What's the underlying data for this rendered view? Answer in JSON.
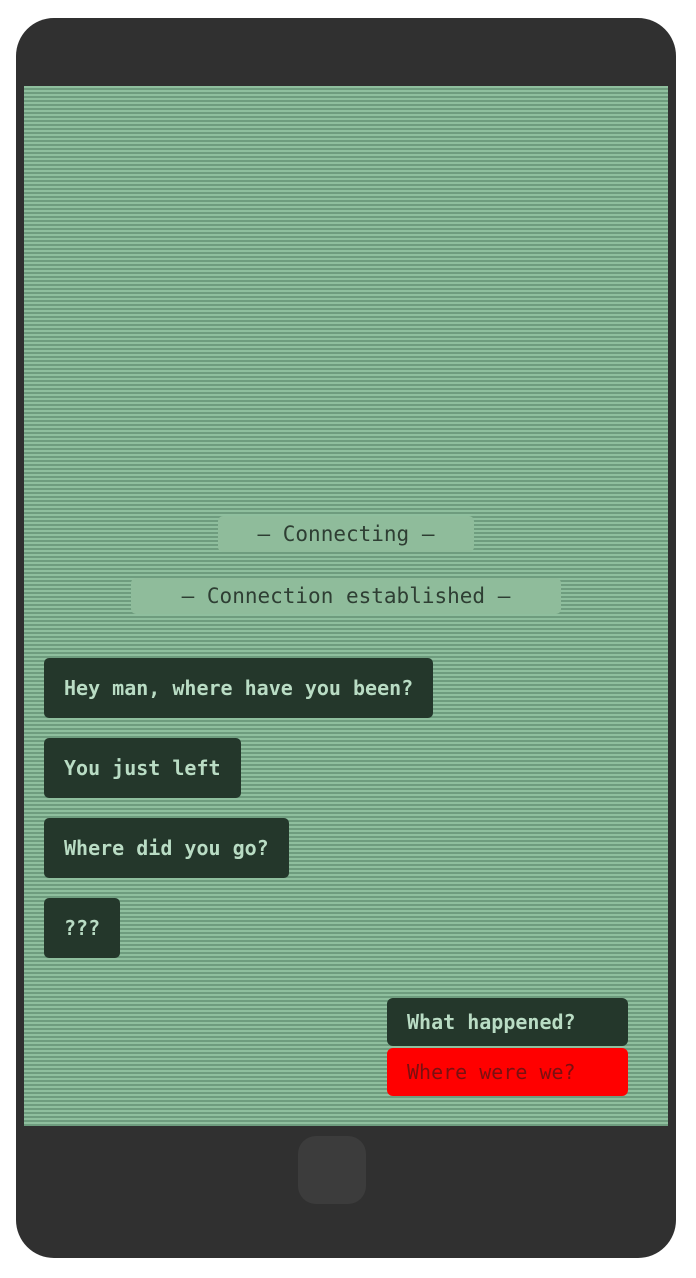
{
  "system_messages": [
    {
      "text": "— Connecting —"
    },
    {
      "text": "— Connection established —"
    }
  ],
  "messages": [
    {
      "text": "Hey man, where have you been?"
    },
    {
      "text": "You just left"
    },
    {
      "text": "Where did you go?"
    },
    {
      "text": "???"
    }
  ],
  "replies": [
    {
      "text": "What happened?"
    },
    {
      "text": "Where were we?"
    }
  ],
  "colors": {
    "phone_body": "#303030",
    "screen": "#86b796",
    "bubble": "#24372b",
    "bubble_text": "#b9dcc4",
    "selected_reply": "#ff0000"
  }
}
